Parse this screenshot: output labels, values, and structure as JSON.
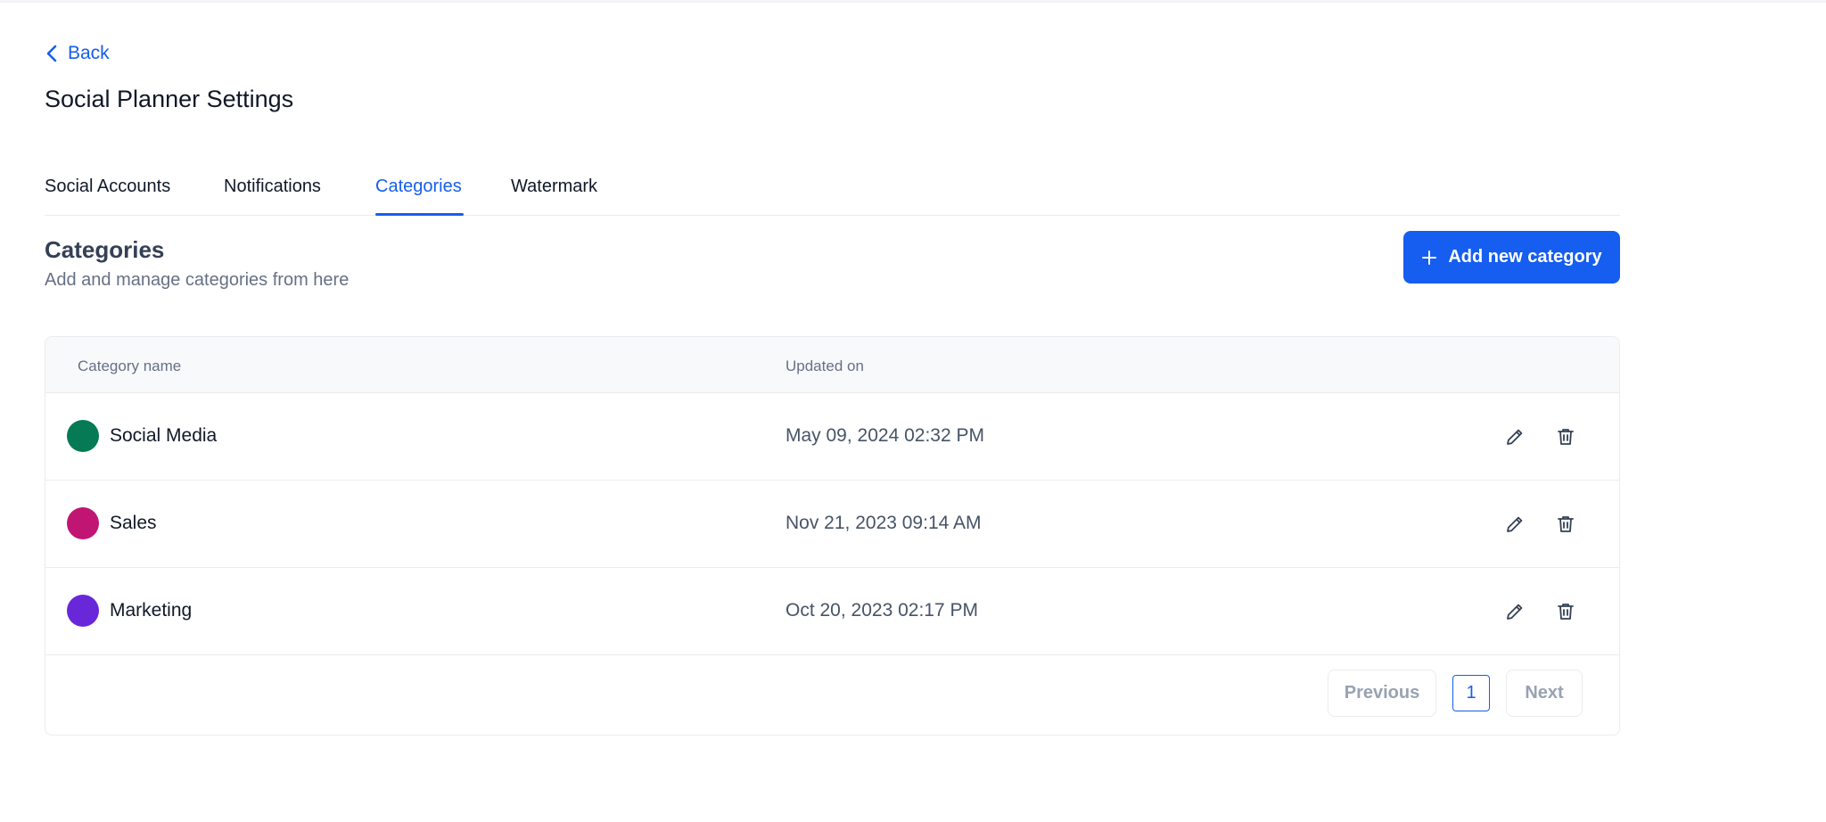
{
  "header": {
    "back_label": "Back",
    "title": "Social Planner Settings"
  },
  "tabs": [
    {
      "label": "Social Accounts",
      "active": false
    },
    {
      "label": "Notifications",
      "active": false
    },
    {
      "label": "Categories",
      "active": true
    },
    {
      "label": "Watermark",
      "active": false
    }
  ],
  "section": {
    "title": "Categories",
    "subtitle": "Add and manage categories from here",
    "add_button_label": "Add new category"
  },
  "table": {
    "columns": [
      "Category name",
      "Updated on"
    ],
    "rows": [
      {
        "name": "Social Media",
        "updated": "May 09, 2024 02:32 PM",
        "color": "#057a55"
      },
      {
        "name": "Sales",
        "updated": "Nov 21, 2023 09:14 AM",
        "color": "#c11574"
      },
      {
        "name": "Marketing",
        "updated": "Oct 20, 2023 02:17 PM",
        "color": "#6927da"
      }
    ]
  },
  "pagination": {
    "previous_label": "Previous",
    "current_page": "1",
    "next_label": "Next"
  },
  "icons": {
    "back": "chevron-left-icon",
    "add": "plus-icon",
    "edit": "pencil-icon",
    "delete": "trash-icon"
  },
  "colors": {
    "accent": "#155eef"
  }
}
